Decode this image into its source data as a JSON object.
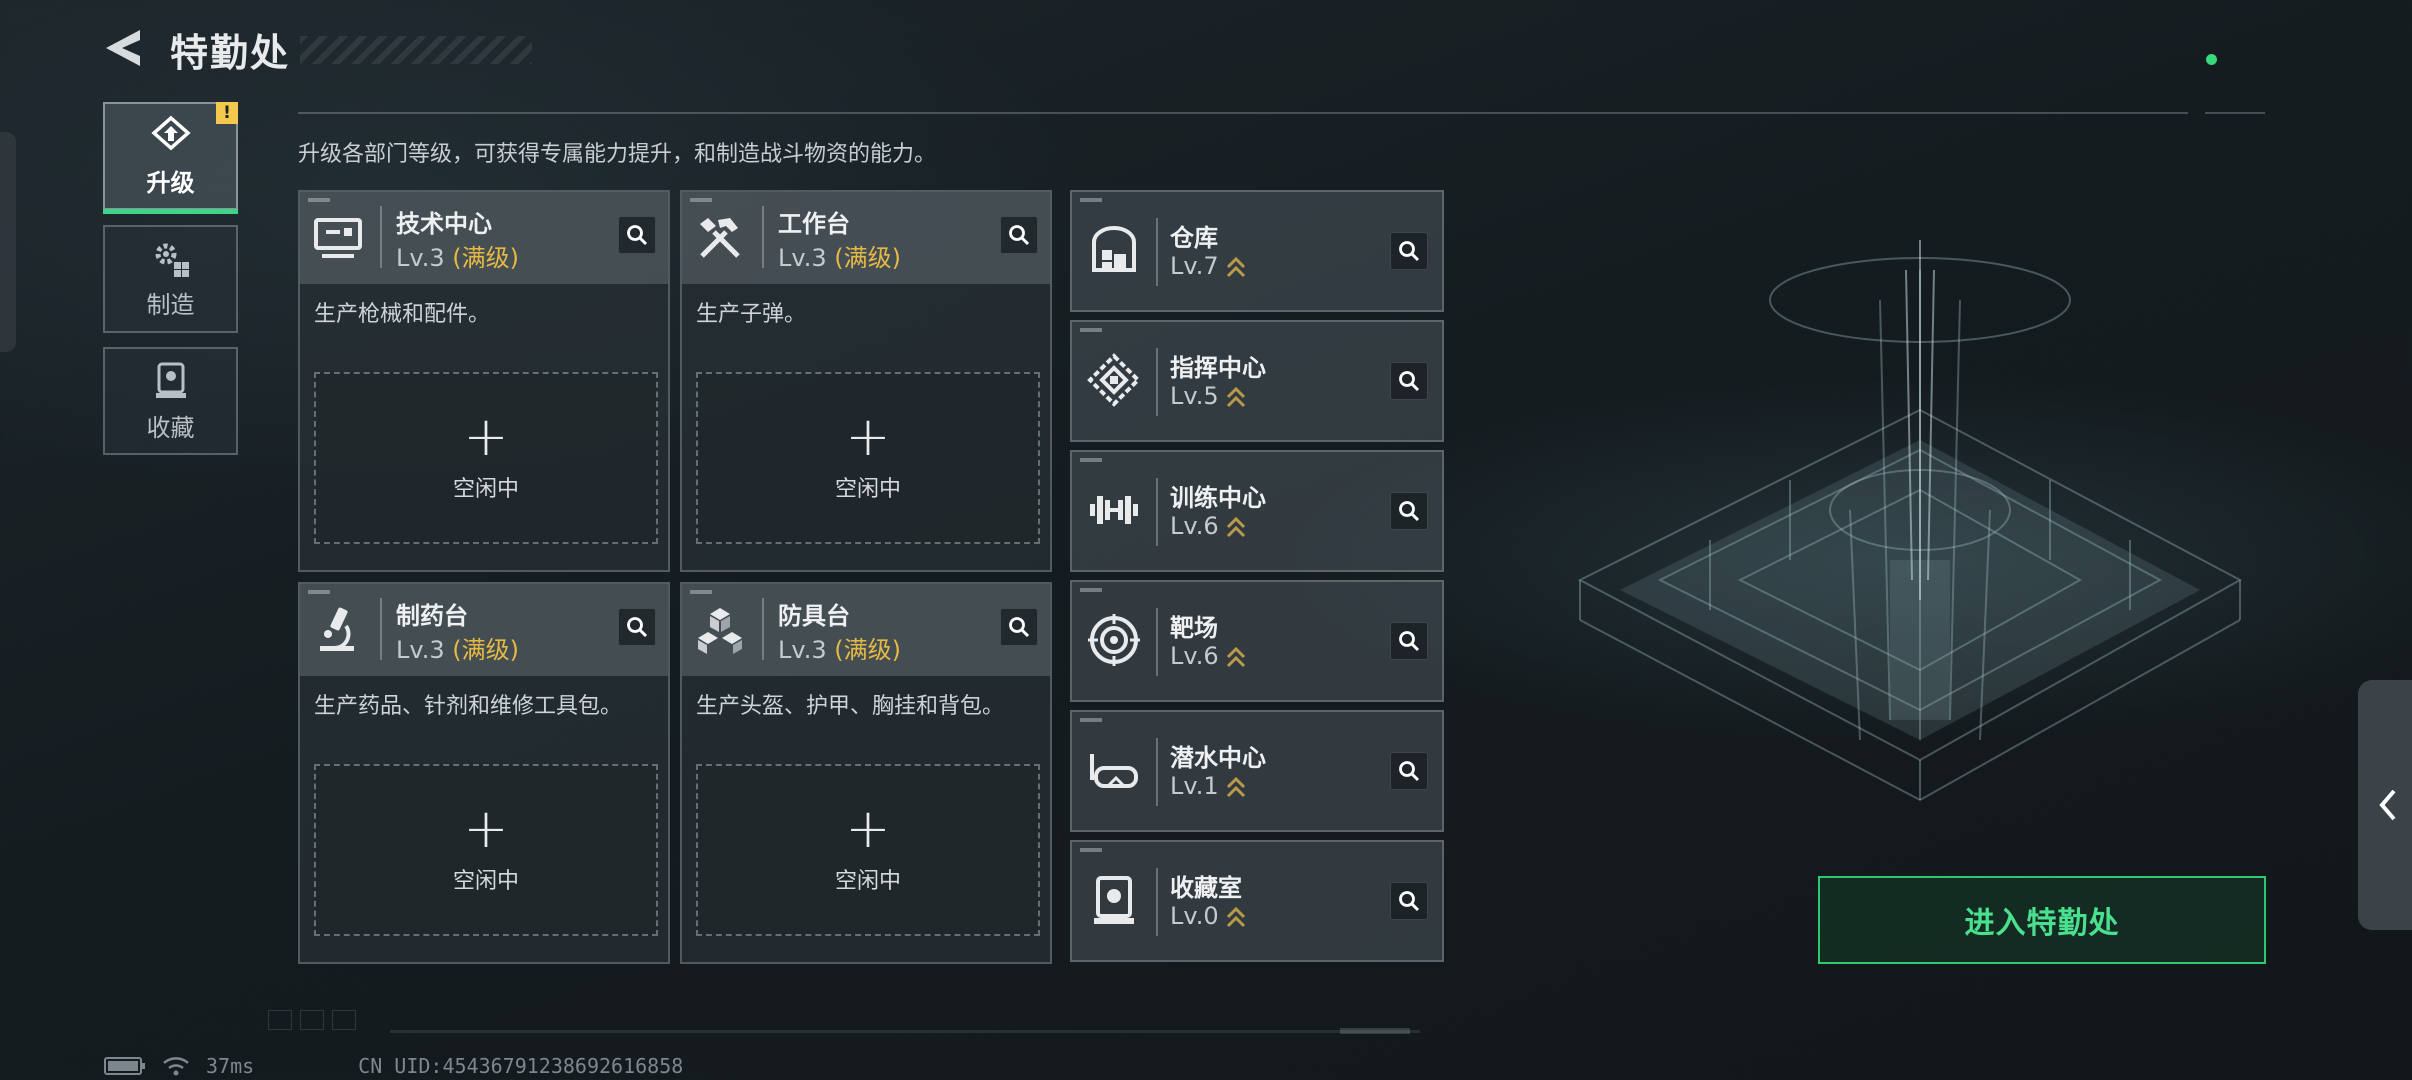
{
  "header": {
    "title": "特勤处"
  },
  "sidebar": {
    "items": [
      {
        "label": "升级",
        "icon": "upgrade-icon",
        "active": true,
        "badge": "!"
      },
      {
        "label": "制造",
        "icon": "gears-icon",
        "active": false
      },
      {
        "label": "收藏",
        "icon": "collection-icon",
        "active": false
      }
    ]
  },
  "main": {
    "description": "升级各部门等级，可获得专属能力提升，和制造战斗物资的能力。",
    "workshops": [
      {
        "name": "技术中心",
        "level": "Lv.3",
        "max": "(满级)",
        "desc": "生产枪械和配件。",
        "slot_plus": "+",
        "slot_status": "空闲中",
        "icon": "computer-icon"
      },
      {
        "name": "工作台",
        "level": "Lv.3",
        "max": "(满级)",
        "desc": "生产子弹。",
        "slot_plus": "+",
        "slot_status": "空闲中",
        "icon": "tools-icon"
      },
      {
        "name": "制药台",
        "level": "Lv.3",
        "max": "(满级)",
        "desc": "生产药品、针剂和维修工具包。",
        "slot_plus": "+",
        "slot_status": "空闲中",
        "icon": "microscope-icon"
      },
      {
        "name": "防具台",
        "level": "Lv.3",
        "max": "(满级)",
        "desc": "生产头盔、护甲、胸挂和背包。",
        "slot_plus": "+",
        "slot_status": "空闲中",
        "icon": "armor-cubes-icon"
      }
    ],
    "facilities": [
      {
        "name": "仓库",
        "level": "Lv.7",
        "icon": "warehouse-icon"
      },
      {
        "name": "指挥中心",
        "level": "Lv.5",
        "icon": "command-icon"
      },
      {
        "name": "训练中心",
        "level": "Lv.6",
        "icon": "dumbbell-icon"
      },
      {
        "name": "靶场",
        "level": "Lv.6",
        "icon": "target-icon"
      },
      {
        "name": "潜水中心",
        "level": "Lv.1",
        "icon": "diving-mask-icon"
      },
      {
        "name": "收藏室",
        "level": "Lv.0",
        "icon": "showcase-icon"
      }
    ]
  },
  "enter_button": "进入特勤处",
  "footer": {
    "ping": "37ms",
    "uid": "CN UID:45436791238692616858"
  },
  "colors": {
    "accent_green": "#3fd48a",
    "max_level_gold": "#e6b944",
    "upgrade_arrow": "#b89a4a"
  }
}
